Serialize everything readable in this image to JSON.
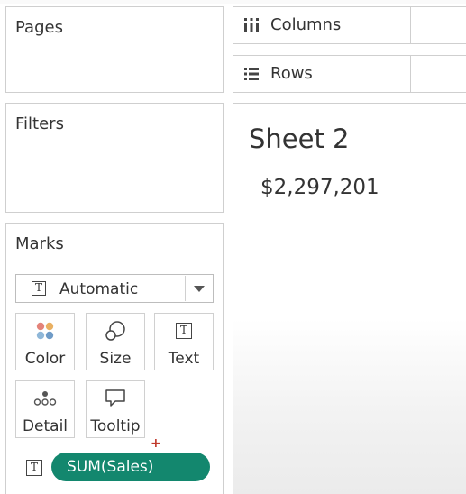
{
  "pages": {
    "title": "Pages"
  },
  "filters": {
    "title": "Filters"
  },
  "marks": {
    "title": "Marks",
    "mark_type": "Automatic",
    "buttons": {
      "color": "Color",
      "size": "Size",
      "text": "Text",
      "detail": "Detail",
      "tooltip": "Tooltip"
    },
    "pill": {
      "label": "SUM(Sales)",
      "color": "#13876e"
    },
    "text_icon_glyph": "T",
    "drop_indicator": "+"
  },
  "shelves": {
    "columns": "Columns",
    "rows": "Rows"
  },
  "view": {
    "sheet_title": "Sheet 2",
    "value": "$2,297,201"
  },
  "icons": {
    "columns": "columns-icon",
    "rows": "rows-icon",
    "color": "color-dots-icon",
    "size": "size-circles-icon",
    "text": "text-t-icon",
    "detail": "detail-dots-icon",
    "tooltip": "tooltip-bubble-icon"
  }
}
